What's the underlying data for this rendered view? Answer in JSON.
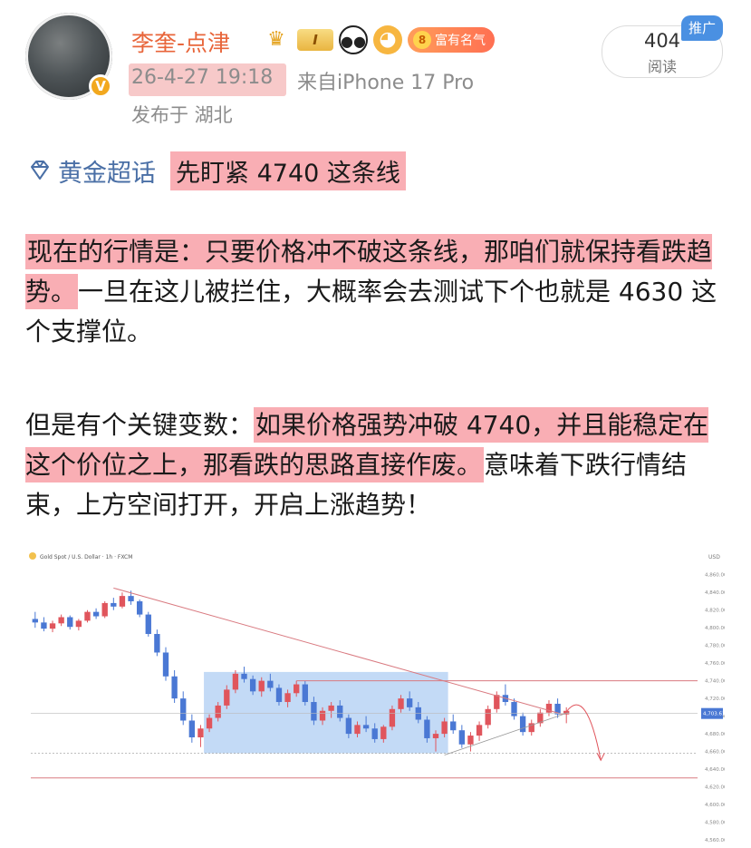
{
  "post": {
    "username": "李奎-点津",
    "vip_level": "I",
    "rich_badge_level": "8",
    "rich_badge_text": "富有名气",
    "timestamp": "26-4-27 19:18",
    "source": "来自iPhone 17 Pro",
    "location": "发布于 湖北",
    "verified_badge": "V"
  },
  "stats": {
    "read_count": "404",
    "read_label": "阅读",
    "promo_tag": "推广"
  },
  "topic": {
    "name": "黄金超话",
    "title": "先盯紧 4740 这条线"
  },
  "paragraphs": {
    "p1_hl": "现在的行情是：只要价格冲不破这条线，那咱们就保持看跌趋势。",
    "p1_rest": "一旦在这儿被拦住，大概率会去测试下个也就是 4630 这个支撑位。",
    "p2_lead": "但是有个关键变数：",
    "p2_hl": "如果价格强势冲破 4740，并且能稳定在这个价位之上，那看跌的思路直接作废。",
    "p2_rest": "意味着下跌行情结束，上方空间打开，开启上涨趋势！"
  },
  "chart": {
    "header": "Gold Spot / U.S. Dollar · 1h · FXCM",
    "currency": "USD",
    "current_price": "4,703.61",
    "colors": {
      "up": "#e0555c",
      "down": "#4a78d4",
      "box": "#b9d3f4",
      "line": "#d97a80"
    }
  },
  "chart_data": {
    "type": "candlestick",
    "title": "Gold Spot / U.S. Dollar · 1h · FXCM",
    "ylabel": "USD",
    "ylim": [
      4560,
      4870
    ],
    "y_ticks": [
      "4,860.00",
      "4,840.00",
      "4,820.00",
      "4,800.00",
      "4,780.00",
      "4,760.00",
      "4,740.00",
      "4,720.00",
      "4,700.00",
      "4,680.00",
      "4,660.00",
      "4,640.00",
      "4,620.00",
      "4,600.00",
      "4,580.00",
      "4,560.00"
    ],
    "resistance": 4740,
    "support": 4630,
    "candles": [
      [
        4810,
        4818,
        4800,
        4806
      ],
      [
        4806,
        4812,
        4796,
        4799
      ],
      [
        4799,
        4808,
        4795,
        4805
      ],
      [
        4805,
        4815,
        4802,
        4812
      ],
      [
        4812,
        4814,
        4798,
        4801
      ],
      [
        4801,
        4810,
        4797,
        4808
      ],
      [
        4808,
        4820,
        4806,
        4818
      ],
      [
        4818,
        4822,
        4810,
        4813
      ],
      [
        4813,
        4830,
        4811,
        4828
      ],
      [
        4828,
        4834,
        4820,
        4824
      ],
      [
        4824,
        4840,
        4822,
        4836
      ],
      [
        4836,
        4842,
        4826,
        4830
      ],
      [
        4830,
        4832,
        4812,
        4815
      ],
      [
        4815,
        4818,
        4790,
        4793
      ],
      [
        4793,
        4798,
        4768,
        4772
      ],
      [
        4772,
        4778,
        4740,
        4745
      ],
      [
        4745,
        4752,
        4715,
        4720
      ],
      [
        4720,
        4728,
        4690,
        4695
      ],
      [
        4695,
        4702,
        4670,
        4676
      ],
      [
        4676,
        4690,
        4665,
        4686
      ],
      [
        4686,
        4702,
        4682,
        4698
      ],
      [
        4698,
        4716,
        4694,
        4712
      ],
      [
        4712,
        4735,
        4708,
        4730
      ],
      [
        4730,
        4752,
        4726,
        4748
      ],
      [
        4748,
        4756,
        4738,
        4742
      ],
      [
        4742,
        4746,
        4724,
        4728
      ],
      [
        4728,
        4744,
        4722,
        4740
      ],
      [
        4740,
        4748,
        4728,
        4732
      ],
      [
        4732,
        4736,
        4712,
        4716
      ],
      [
        4716,
        4730,
        4710,
        4726
      ],
      [
        4726,
        4740,
        4722,
        4736
      ],
      [
        4736,
        4740,
        4712,
        4716
      ],
      [
        4716,
        4722,
        4690,
        4695
      ],
      [
        4695,
        4710,
        4690,
        4706
      ],
      [
        4706,
        4716,
        4698,
        4712
      ],
      [
        4712,
        4718,
        4694,
        4698
      ],
      [
        4698,
        4702,
        4675,
        4680
      ],
      [
        4680,
        4694,
        4676,
        4690
      ],
      [
        4690,
        4700,
        4682,
        4686
      ],
      [
        4686,
        4692,
        4670,
        4674
      ],
      [
        4674,
        4690,
        4670,
        4688
      ],
      [
        4688,
        4712,
        4684,
        4708
      ],
      [
        4708,
        4724,
        4704,
        4720
      ],
      [
        4720,
        4728,
        4706,
        4710
      ],
      [
        4710,
        4716,
        4692,
        4696
      ],
      [
        4696,
        4700,
        4670,
        4675
      ],
      [
        4675,
        4684,
        4660,
        4680
      ],
      [
        4680,
        4698,
        4676,
        4694
      ],
      [
        4694,
        4702,
        4680,
        4684
      ],
      [
        4684,
        4690,
        4664,
        4668
      ],
      [
        4668,
        4682,
        4660,
        4678
      ],
      [
        4678,
        4694,
        4672,
        4690
      ],
      [
        4690,
        4712,
        4686,
        4708
      ],
      [
        4708,
        4728,
        4704,
        4724
      ],
      [
        4724,
        4736,
        4712,
        4716
      ],
      [
        4716,
        4720,
        4696,
        4700
      ],
      [
        4700,
        4704,
        4678,
        4682
      ],
      [
        4682,
        4696,
        4678,
        4692
      ],
      [
        4692,
        4708,
        4688,
        4704
      ],
      [
        4704,
        4718,
        4700,
        4714
      ],
      [
        4714,
        4720,
        4698,
        4702
      ],
      [
        4702,
        4710,
        4692,
        4706
      ]
    ]
  }
}
